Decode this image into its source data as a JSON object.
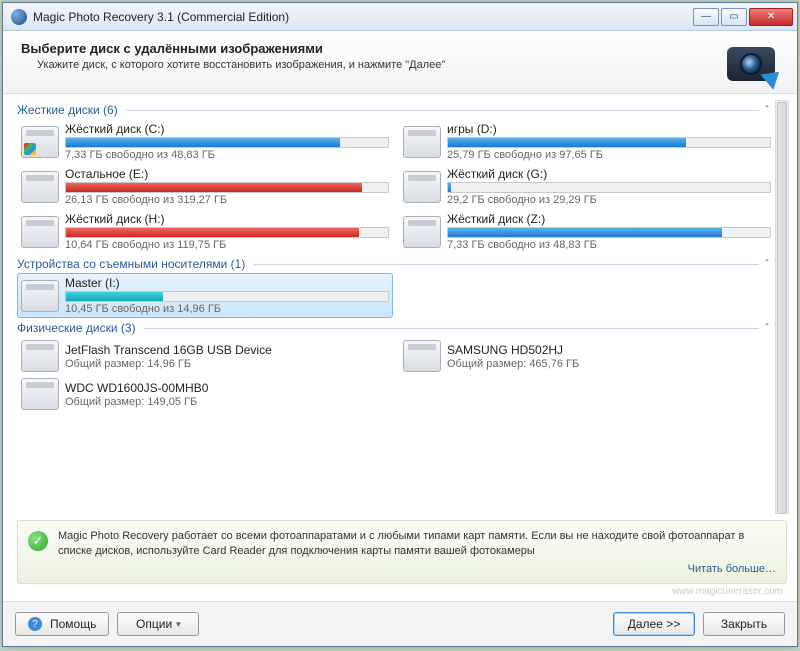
{
  "window_title": "Magic Photo Recovery 3.1 (Commercial Edition)",
  "header": {
    "title": "Выберите диск с удалёнными изображениями",
    "subtitle": "Укажите диск, с которого хотите восстановить изображения, и нажмите \"Далее\""
  },
  "groups": {
    "hdd_label": "Жесткие диски (6)",
    "removable_label": "Устройства со съемными носителями (1)",
    "physical_label": "Физические диски (3)"
  },
  "hdd": [
    {
      "name": "Жёсткий диск (C:)",
      "free": "7,33 ГБ свободно из 48,83 ГБ",
      "fill": 85,
      "color": "blue",
      "os": true
    },
    {
      "name": "игры (D:)",
      "free": "25,79 ГБ свободно из 97,65 ГБ",
      "fill": 74,
      "color": "blue"
    },
    {
      "name": "Остальное (E:)",
      "free": "26,13 ГБ свободно из 319,27 ГБ",
      "fill": 92,
      "color": "red"
    },
    {
      "name": "Жёсткий диск (G:)",
      "free": "29,2 ГБ свободно из 29,29 ГБ",
      "fill": 1,
      "color": "blue"
    },
    {
      "name": "Жёсткий диск (H:)",
      "free": "10,64 ГБ свободно из 119,75 ГБ",
      "fill": 91,
      "color": "red"
    },
    {
      "name": "Жёсткий диск (Z:)",
      "free": "7,33 ГБ свободно из 48,83 ГБ",
      "fill": 85,
      "color": "blue"
    }
  ],
  "removable": [
    {
      "name": "Master (I:)",
      "free": "10,45 ГБ свободно из 14,96 ГБ",
      "fill": 30,
      "color": "teal",
      "selected": true
    }
  ],
  "physical": [
    {
      "name": "JetFlash Transcend 16GB USB Device",
      "sub": "Общий размер: 14,96 ГБ"
    },
    {
      "name": "SAMSUNG HD502HJ",
      "sub": "Общий размер: 465,76 ГБ"
    },
    {
      "name": "WDC WD1600JS-00MHB0",
      "sub": "Общий размер: 149,05 ГБ"
    }
  ],
  "tip": {
    "text": "Magic Photo Recovery работает со всеми фотоаппаратами и с любыми типами карт памяти. Если вы не находите свой фотоаппарат в списке дисков, используйте Card Reader для подключения карты памяти вашей фотокамеры",
    "link": "Читать больше…"
  },
  "watermark": "www.magicuneraser.com",
  "buttons": {
    "help": "Помощь",
    "options": "Опции",
    "next": "Далее >>",
    "close": "Закрыть"
  }
}
